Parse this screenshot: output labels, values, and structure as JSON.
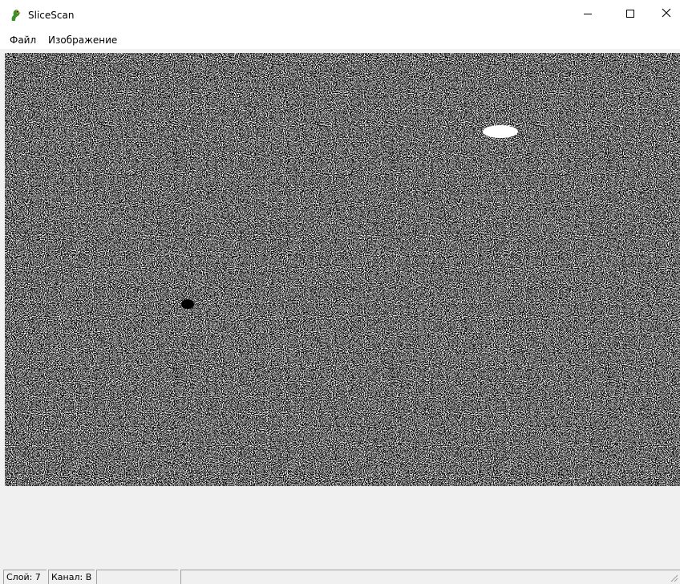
{
  "window": {
    "title": "SliceScan",
    "icon": "parrot-app-icon"
  },
  "caption_buttons": {
    "minimize_icon": "minimize-icon",
    "maximize_icon": "maximize-icon",
    "close_icon": "close-icon"
  },
  "menu": {
    "items": [
      {
        "label": "Файл"
      },
      {
        "label": "Изображение"
      }
    ]
  },
  "image": {
    "description_icon": "noise-slice-image"
  },
  "status": {
    "layer": "Слой: 7",
    "channel": "Канал: B",
    "panel3": "",
    "panel4": ""
  }
}
